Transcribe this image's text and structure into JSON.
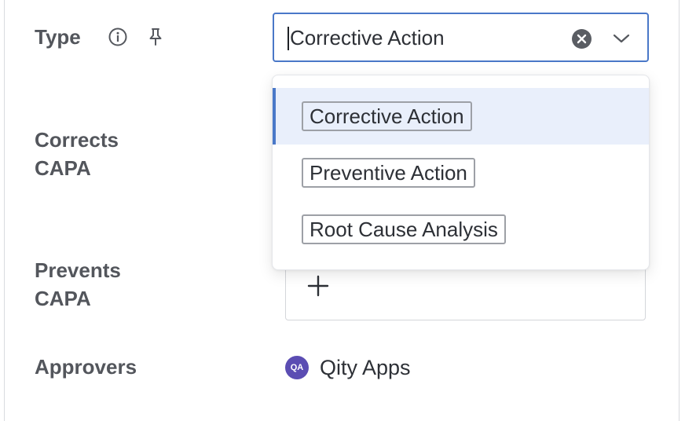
{
  "fields": {
    "type_label": "Type",
    "corrects_label_line1": "Corrects",
    "corrects_label_line2": "CAPA",
    "prevents_label_line1": "Prevents",
    "prevents_label_line2": "CAPA",
    "approvers_label": "Approvers"
  },
  "icons": {
    "info": "info-icon",
    "pin": "pin-icon",
    "clear": "clear-icon",
    "chevron": "chevron-down-icon",
    "plus": "plus-icon"
  },
  "type_select": {
    "value": "Corrective Action",
    "options": [
      {
        "label": "Corrective Action",
        "selected": true
      },
      {
        "label": "Preventive Action",
        "selected": false
      },
      {
        "label": "Root Cause Analysis",
        "selected": false
      }
    ]
  },
  "approvers": [
    {
      "initials": "QA",
      "name": "Qity Apps",
      "avatar_color": "#5b4db3"
    }
  ],
  "colors": {
    "accent": "#4a78c8",
    "selected_bg": "#e9effb",
    "label": "#53565c"
  }
}
